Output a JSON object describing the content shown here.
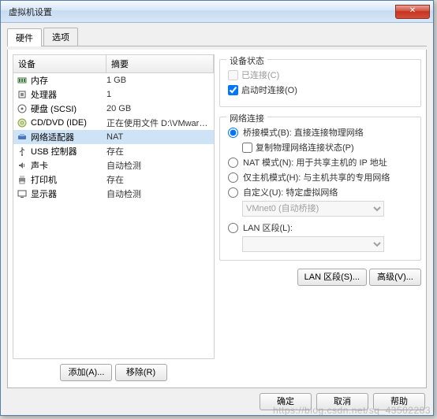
{
  "window": {
    "title": "虚拟机设置"
  },
  "tabs": {
    "hardware": "硬件",
    "options": "选项"
  },
  "columns": {
    "device": "设备",
    "summary": "摘要"
  },
  "devices": [
    {
      "name": "内存",
      "summary": "1 GB",
      "icon": "memory-icon"
    },
    {
      "name": "处理器",
      "summary": "1",
      "icon": "cpu-icon"
    },
    {
      "name": "硬盘 (SCSI)",
      "summary": "20 GB",
      "icon": "disk-icon"
    },
    {
      "name": "CD/DVD (IDE)",
      "summary": "正在使用文件 D:\\VMwareCent...",
      "icon": "cd-icon"
    },
    {
      "name": "网络适配器",
      "summary": "NAT",
      "icon": "net-icon",
      "selected": true
    },
    {
      "name": "USB 控制器",
      "summary": "存在",
      "icon": "usb-icon"
    },
    {
      "name": "声卡",
      "summary": "自动检测",
      "icon": "sound-icon"
    },
    {
      "name": "打印机",
      "summary": "存在",
      "icon": "printer-icon"
    },
    {
      "name": "显示器",
      "summary": "自动检测",
      "icon": "display-icon"
    }
  ],
  "leftButtons": {
    "add": "添加(A)...",
    "remove": "移除(R)"
  },
  "status": {
    "legend": "设备状态",
    "connected": "已连接(C)",
    "connectedChecked": false,
    "connectOnStart": "启动时连接(O)",
    "connectOnStartChecked": true
  },
  "network": {
    "legend": "网络连接",
    "bridged": "桥接模式(B): 直接连接物理网络",
    "replicate": "复制物理网络连接状态(P)",
    "replicateChecked": false,
    "nat": "NAT 模式(N): 用于共享主机的 IP 地址",
    "hostOnly": "仅主机模式(H): 与主机共享的专用网络",
    "custom": "自定义(U): 特定虚拟网络",
    "customCombo": "VMnet0 (自动桥接)",
    "lan": "LAN 区段(L):",
    "lanCombo": "",
    "selected": "bridged"
  },
  "rightButtons": {
    "lan": "LAN 区段(S)...",
    "advanced": "高级(V)..."
  },
  "bottom": {
    "ok": "确定",
    "cancel": "取消",
    "help": "帮助"
  },
  "watermark": "https://blog.csdn.net/sq_43502283"
}
